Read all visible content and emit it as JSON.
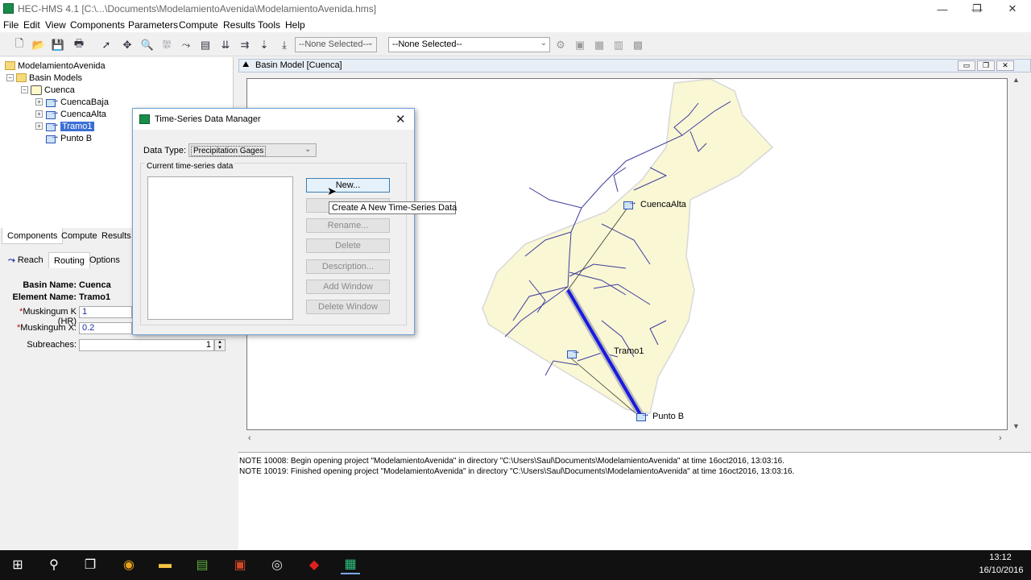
{
  "window": {
    "title": "HEC-HMS 4.1 [C:\\...\\Documents\\ModelamientoAvenida\\ModelamientoAvenida.hms]",
    "controls": {
      "minimize": "—",
      "restore": "❐",
      "close": "✕"
    }
  },
  "menu": [
    "File",
    "Edit",
    "View",
    "Components",
    "Parameters",
    "Compute",
    "Results",
    "Tools",
    "Help"
  ],
  "toolbar": {
    "combo1": "--None Selected--",
    "combo2": "--None Selected--"
  },
  "tree": {
    "root": "ModelamientoAvenida",
    "basin_models": "Basin Models",
    "basin": "Cuenca",
    "items": [
      "CuencaBaja",
      "CuencaAlta",
      "Tramo1",
      "Punto B"
    ]
  },
  "left_tabs": [
    "Components",
    "Compute",
    "Results"
  ],
  "prop_tabs": [
    "Reach",
    "Routing",
    "Options"
  ],
  "properties": {
    "basin_name_label": "Basin Name:",
    "basin_name": "Cuenca",
    "element_name_label": "Element Name:",
    "element_name": "Tramo1",
    "k_label": "Muskingum K (HR)",
    "k_value": "1",
    "x_label": "Muskingum X:",
    "x_value": "0.2",
    "subreaches_label": "Subreaches:",
    "subreaches_value": "1",
    "required_marker": "*"
  },
  "basin_window": {
    "title": "Basin Model [Cuenca]",
    "labels": {
      "cuenca_alta": "CuencaAlta",
      "tramo1": "Tramo1",
      "punto_b": "Punto B"
    }
  },
  "dialog": {
    "title": "Time-Series Data Manager",
    "data_type_label": "Data Type:",
    "data_type_value": "Precipitation Gages",
    "list_label": "Current time-series data",
    "buttons": {
      "new": "New...",
      "copy": "",
      "rename": "Rename...",
      "delete": "Delete",
      "description": "Description...",
      "add_window": "Add Window",
      "delete_window": "Delete Window"
    },
    "tooltip": "Create A New Time-Series Data"
  },
  "messages": [
    "NOTE 10008:  Begin opening project \"ModelamientoAvenida\" in directory \"C:\\Users\\Saul\\Documents\\ModelamientoAvenida\" at time 16oct2016, 13:03:16.",
    "NOTE 10019:  Finished opening project \"ModelamientoAvenida\" in directory \"C:\\Users\\Saul\\Documents\\ModelamientoAvenida\" at time 16oct2016, 13:03:16."
  ],
  "taskbar": {
    "time": "13:12",
    "date": "16/10/2016"
  },
  "colors": {
    "basin_fill": "#faf7d5",
    "reach": "#1a1adf",
    "streams": "#3c3c9c",
    "selection": "#3b6fd6"
  }
}
